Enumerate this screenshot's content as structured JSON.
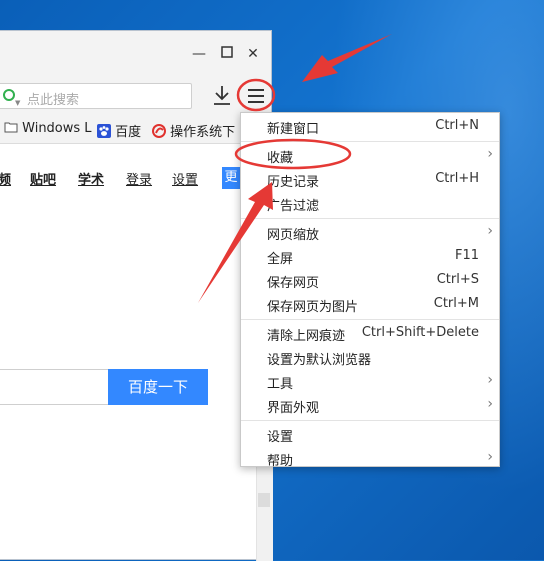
{
  "address_bar": {
    "placeholder": "点此搜索"
  },
  "bookmarks": [
    {
      "label": "Windows L",
      "icon": "folder-icon"
    },
    {
      "label": "百度",
      "icon": "baidu-paw-icon"
    },
    {
      "label": "操作系统下",
      "icon": "bookmark-favicon-icon"
    }
  ],
  "nav_links": [
    "频",
    "贴吧",
    "学术",
    "登录",
    "设置"
  ],
  "more_tab": "更",
  "search_button": "百度一下",
  "menu": {
    "items": [
      {
        "label": "新建窗口",
        "shortcut": "Ctrl+N"
      },
      {
        "label": "收藏",
        "submenu": "›"
      },
      {
        "label": "历史记录",
        "shortcut": "Ctrl+H"
      },
      {
        "label": "广告过滤"
      },
      {
        "label": "网页缩放",
        "submenu": "›"
      },
      {
        "label": "全屏",
        "shortcut": "F11"
      },
      {
        "label": "保存网页",
        "shortcut": "Ctrl+S"
      },
      {
        "label": "保存网页为图片",
        "shortcut": "Ctrl+M"
      },
      {
        "label": "清除上网痕迹",
        "shortcut": "Ctrl+Shift+Delete"
      },
      {
        "label": "设置为默认浏览器"
      },
      {
        "label": "工具",
        "submenu": "›"
      },
      {
        "label": "界面外观",
        "submenu": "›"
      },
      {
        "label": "设置"
      },
      {
        "label": "帮助",
        "submenu": "›"
      }
    ]
  },
  "colors": {
    "accent_blue": "#3388ff",
    "annotation_red": "#e53935",
    "desktop_blue": "#1474d0"
  }
}
